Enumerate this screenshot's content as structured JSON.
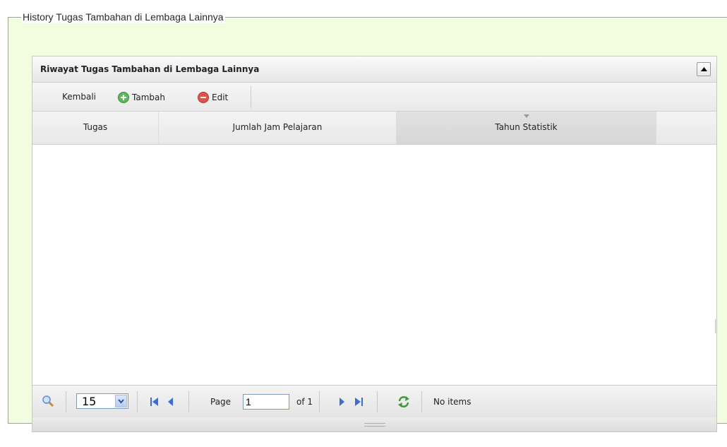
{
  "fieldset": {
    "legend": "History Tugas Tambahan di Lembaga Lainnya"
  },
  "grid": {
    "title": "Riwayat Tugas Tambahan di Lembaga Lainnya",
    "toolbar": {
      "back_label": "Kembali",
      "add_label": "Tambah",
      "edit_label": "Edit",
      "add_icon": "plus-circle-icon",
      "edit_icon": "minus-circle-icon"
    },
    "columns": [
      "Tugas",
      "Jumlah Jam Pelajaran",
      "Tahun Statistik",
      ""
    ],
    "sorted_column": "Tahun Statistik",
    "pager": {
      "page_size": "15",
      "page_label": "Page",
      "page_value": "1",
      "of_label": "of 1",
      "status": "No items"
    }
  },
  "colors": {
    "fieldset_bg": "#f2fde0",
    "add_green": "#5cb85c",
    "edit_red": "#e0534a",
    "nav_blue": "#3a6fd8",
    "refresh_green": "#3f9c35"
  }
}
